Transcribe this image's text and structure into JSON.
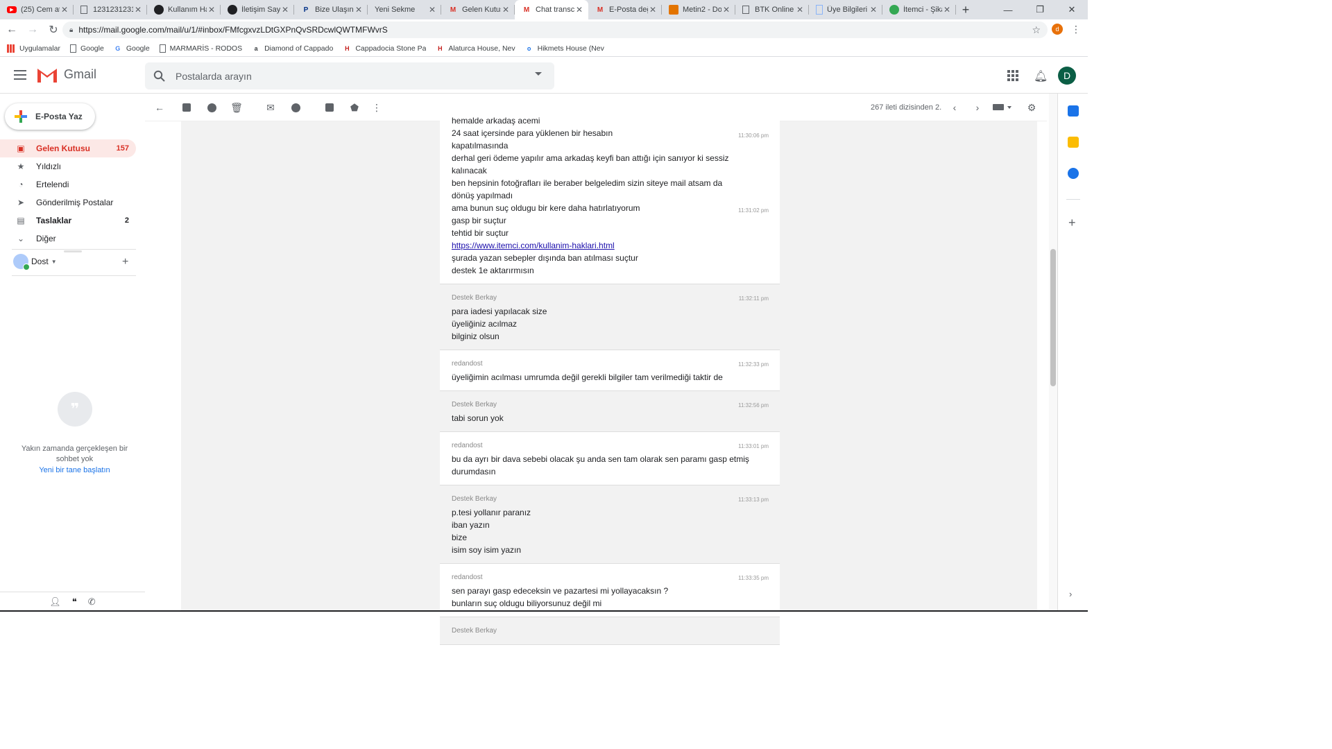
{
  "browser": {
    "tabs": [
      {
        "label": "(25) Cem ata",
        "icon": "youtube-icon",
        "color": "#ff0000"
      },
      {
        "label": "1231231231",
        "icon": "document-icon",
        "color": "#5f6368"
      },
      {
        "label": "Kullanım Ha",
        "icon": "site-dark-icon",
        "color": "#202124"
      },
      {
        "label": "İletişim Sayf",
        "icon": "site-dark-icon",
        "color": "#202124"
      },
      {
        "label": "Bize Ulaşın -",
        "icon": "paypal-icon",
        "color": "#003087"
      },
      {
        "label": "Yeni Sekme",
        "icon": "",
        "color": ""
      },
      {
        "label": "Gelen Kutus",
        "icon": "gmail-icon",
        "color": "#d93025"
      },
      {
        "label": "Chat transcr",
        "icon": "gmail-icon",
        "color": "#d93025"
      },
      {
        "label": "E-Posta değ",
        "icon": "gmail-icon",
        "color": "#d93025"
      },
      {
        "label": "Metin2 - Do",
        "icon": "metin2-icon",
        "color": "#e37400"
      },
      {
        "label": "BTK Online",
        "icon": "document-icon",
        "color": "#5f6368"
      },
      {
        "label": "Üye Bilgileri",
        "icon": "page-icon",
        "color": "#8ab4f8"
      },
      {
        "label": "İtemci - Şika",
        "icon": "itemci-icon",
        "color": "#34a853"
      }
    ],
    "active_tab": 7,
    "new_tab_glyph": "+",
    "url": "https://mail.google.com/mail/u/1/#inbox/FMfcgxvzLDtGXPnQvSRDcwlQWTMFWvrS",
    "profile_letter": "d",
    "bookmarks": [
      {
        "label": "Uygulamalar",
        "icon": "apps-grid-icon"
      },
      {
        "label": "Google",
        "icon": "document-icon"
      },
      {
        "label": "Google",
        "icon": "google-icon"
      },
      {
        "label": "MARMARİS - RODOS",
        "icon": "document-icon"
      },
      {
        "label": "Diamond of Cappado",
        "icon": "tripadvisor-icon"
      },
      {
        "label": "Cappadocia Stone Pa",
        "icon": "hotel-icon"
      },
      {
        "label": "Alaturca House, Nev",
        "icon": "hotel-icon"
      },
      {
        "label": "Hikmets House (Nev",
        "icon": "booking-icon"
      }
    ]
  },
  "gmail": {
    "logo_text": "Gmail",
    "search_placeholder": "Postalarda arayın",
    "avatar_letter": "D",
    "compose_label": "E-Posta Yaz",
    "nav": [
      {
        "label": "Gelen Kutusu",
        "count": "157",
        "icon": "inbox-icon",
        "glyph": "▣"
      },
      {
        "label": "Yıldızlı",
        "count": "",
        "icon": "star-icon",
        "glyph": "★"
      },
      {
        "label": "Ertelendi",
        "count": "",
        "icon": "clock-icon",
        "glyph": "◔"
      },
      {
        "label": "Gönderilmiş Postalar",
        "count": "",
        "icon": "send-icon",
        "glyph": "➤"
      },
      {
        "label": "Taslaklar",
        "count": "2",
        "icon": "draft-icon",
        "glyph": "▤"
      },
      {
        "label": "Diğer",
        "count": "",
        "icon": "chevron-down-icon",
        "glyph": "⌄"
      }
    ],
    "hangouts_user": "Dost",
    "chat_empty_text": "Yakın zamanda gerçekleşen bir sohbet yok",
    "chat_start_link": "Yeni bir tane başlatın",
    "pager_text": "267 ileti dizisinden 2.",
    "transcript": [
      {
        "sender": "",
        "time": "11:30:06 pm",
        "role": "visitor",
        "lines": [
          {
            "text": "hemalde arkadaş acemi",
            "time": ""
          },
          {
            "text": "24 saat içersinde para yüklenen bir hesabın",
            "time": "11:30:06 pm"
          },
          {
            "text": "kapatılmasında",
            "time": ""
          },
          {
            "text": "derhal geri ödeme yapılır ama arkadaş keyfi ban attığı için sanıyor ki sessiz",
            "time": ""
          },
          {
            "text": "kalınacak",
            "time": ""
          },
          {
            "text": "ben hepsinin fotoğrafları ile beraber belgeledim sizin siteye mail atsam da",
            "time": ""
          },
          {
            "text": "dönüş yapılmadı",
            "time": ""
          },
          {
            "text": "ama bunun suç oldugu bir kere daha hatırlatıyorum",
            "time": "11:31:02 pm"
          },
          {
            "text": "gasp bir suçtur",
            "time": ""
          },
          {
            "text": "tehtid bir suçtur",
            "time": ""
          },
          {
            "text": "https://www.itemci.com/kullanim-haklari.html",
            "time": "",
            "link": true
          },
          {
            "text": "şurada yazan sebepler dışında ban atılması suçtur",
            "time": ""
          },
          {
            "text": "destek 1e aktarırmısın",
            "time": ""
          }
        ]
      },
      {
        "sender": "Destek Berkay",
        "time": "11:32:11 pm",
        "role": "agent",
        "lines": [
          {
            "text": "para iadesi yapılacak size",
            "time": ""
          },
          {
            "text": "üyeliğiniz acılmaz",
            "time": ""
          },
          {
            "text": "bilginiz olsun",
            "time": ""
          }
        ]
      },
      {
        "sender": "redandost",
        "time": "11:32:33 pm",
        "role": "visitor",
        "lines": [
          {
            "text": "üyeliğimin acılması umrumda değil gerekli bilgiler tam verilmediği taktir de",
            "time": ""
          }
        ]
      },
      {
        "sender": "Destek Berkay",
        "time": "11:32:56 pm",
        "role": "agent",
        "lines": [
          {
            "text": "tabi sorun yok",
            "time": ""
          }
        ]
      },
      {
        "sender": "redandost",
        "time": "11:33:01 pm",
        "role": "visitor",
        "lines": [
          {
            "text": "bu da ayrı bir dava sebebi olacak şu anda sen tam olarak sen paramı gasp etmiş",
            "time": ""
          },
          {
            "text": "durumdasın",
            "time": ""
          }
        ]
      },
      {
        "sender": "Destek Berkay",
        "time": "11:33:13 pm",
        "role": "agent",
        "lines": [
          {
            "text": "p.tesi yollanır paranız",
            "time": ""
          },
          {
            "text": "iban yazın",
            "time": ""
          },
          {
            "text": "bize",
            "time": ""
          },
          {
            "text": "isim soy isim yazın",
            "time": ""
          }
        ]
      },
      {
        "sender": "redandost",
        "time": "11:33:35 pm",
        "role": "visitor",
        "lines": [
          {
            "text": "sen parayı gasp edeceksin ve pazartesi mi yollayacaksın ?",
            "time": ""
          },
          {
            "text": "bunların suç oldugu biliyorsunuz değil mi",
            "time": ""
          }
        ]
      },
      {
        "sender": "Destek Berkay",
        "time": "",
        "role": "agent",
        "lines": []
      }
    ],
    "colors": {
      "accent_red": "#d93025",
      "active_bg": "#fce8e6",
      "link_blue": "#1a73e8",
      "avatar_green": "#0b5e45"
    }
  }
}
